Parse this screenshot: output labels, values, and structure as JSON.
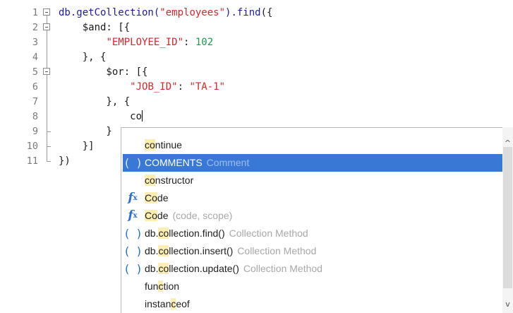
{
  "editor": {
    "lines": [
      {
        "n": "1",
        "parts": [
          [
            "fn",
            "db.getCollection("
          ],
          [
            "str",
            "\"employees\""
          ],
          [
            "fn",
            ").find"
          ],
          [
            "",
            "({"
          ]
        ]
      },
      {
        "n": "2",
        "parts": [
          [
            "",
            "    $and: [{"
          ]
        ]
      },
      {
        "n": "3",
        "parts": [
          [
            "",
            "        "
          ],
          [
            "str",
            "\"EMPLOYEE_ID\""
          ],
          [
            "",
            ": "
          ],
          [
            "num",
            "102"
          ]
        ]
      },
      {
        "n": "4",
        "parts": [
          [
            "",
            "    }, {"
          ]
        ]
      },
      {
        "n": "5",
        "parts": [
          [
            "",
            "        $or: [{"
          ]
        ]
      },
      {
        "n": "6",
        "parts": [
          [
            "",
            "            "
          ],
          [
            "str",
            "\"JOB_ID\""
          ],
          [
            "",
            ": "
          ],
          [
            "str",
            "\"TA-1\""
          ]
        ]
      },
      {
        "n": "7",
        "parts": [
          [
            "",
            "        }, {"
          ]
        ]
      },
      {
        "n": "8",
        "parts": [
          [
            "",
            "            co"
          ]
        ]
      },
      {
        "n": "9",
        "parts": [
          [
            "",
            "        }"
          ]
        ]
      },
      {
        "n": "10",
        "parts": [
          [
            "",
            "    }]"
          ]
        ]
      },
      {
        "n": "11",
        "parts": [
          [
            "",
            "})"
          ]
        ]
      }
    ]
  },
  "autocomplete": {
    "items": [
      {
        "icon": "none",
        "pre": "",
        "match": "co",
        "post": "ntinue",
        "desc": "",
        "selected": false
      },
      {
        "icon": "paren",
        "pre": "",
        "match": "CO",
        "post": "MMENTS",
        "desc": "Comment",
        "selected": true
      },
      {
        "icon": "none",
        "pre": "",
        "match": "co",
        "post": "nstructor",
        "desc": "",
        "selected": false
      },
      {
        "icon": "fx",
        "pre": "",
        "match": "Co",
        "post": "de",
        "desc": "",
        "selected": false
      },
      {
        "icon": "fx",
        "pre": "",
        "match": "Co",
        "post": "de",
        "desc": "(code, scope)",
        "selected": false
      },
      {
        "icon": "paren",
        "pre": "db.",
        "match": "co",
        "post": "llection.find()",
        "desc": "Collection Method",
        "selected": false
      },
      {
        "icon": "paren",
        "pre": "db.",
        "match": "co",
        "post": "llection.insert()",
        "desc": "Collection Method",
        "selected": false
      },
      {
        "icon": "paren",
        "pre": "db.",
        "match": "co",
        "post": "llection.update()",
        "desc": "Collection Method",
        "selected": false
      },
      {
        "icon": "none",
        "pre": "fun",
        "match": "c",
        "post": "tion",
        "desc": "",
        "selected": false
      },
      {
        "icon": "none",
        "pre": "instan",
        "match": "c",
        "post": "eof",
        "desc": "",
        "selected": false
      }
    ]
  },
  "icons": {
    "paren": "method-icon",
    "fx": "function-icon"
  },
  "colors": {
    "selection": "#3a78d6",
    "string": "#d8262c",
    "number": "#1e9a48",
    "keyword": "#1b1b9e",
    "match_highlight": "#fbeeb0"
  }
}
